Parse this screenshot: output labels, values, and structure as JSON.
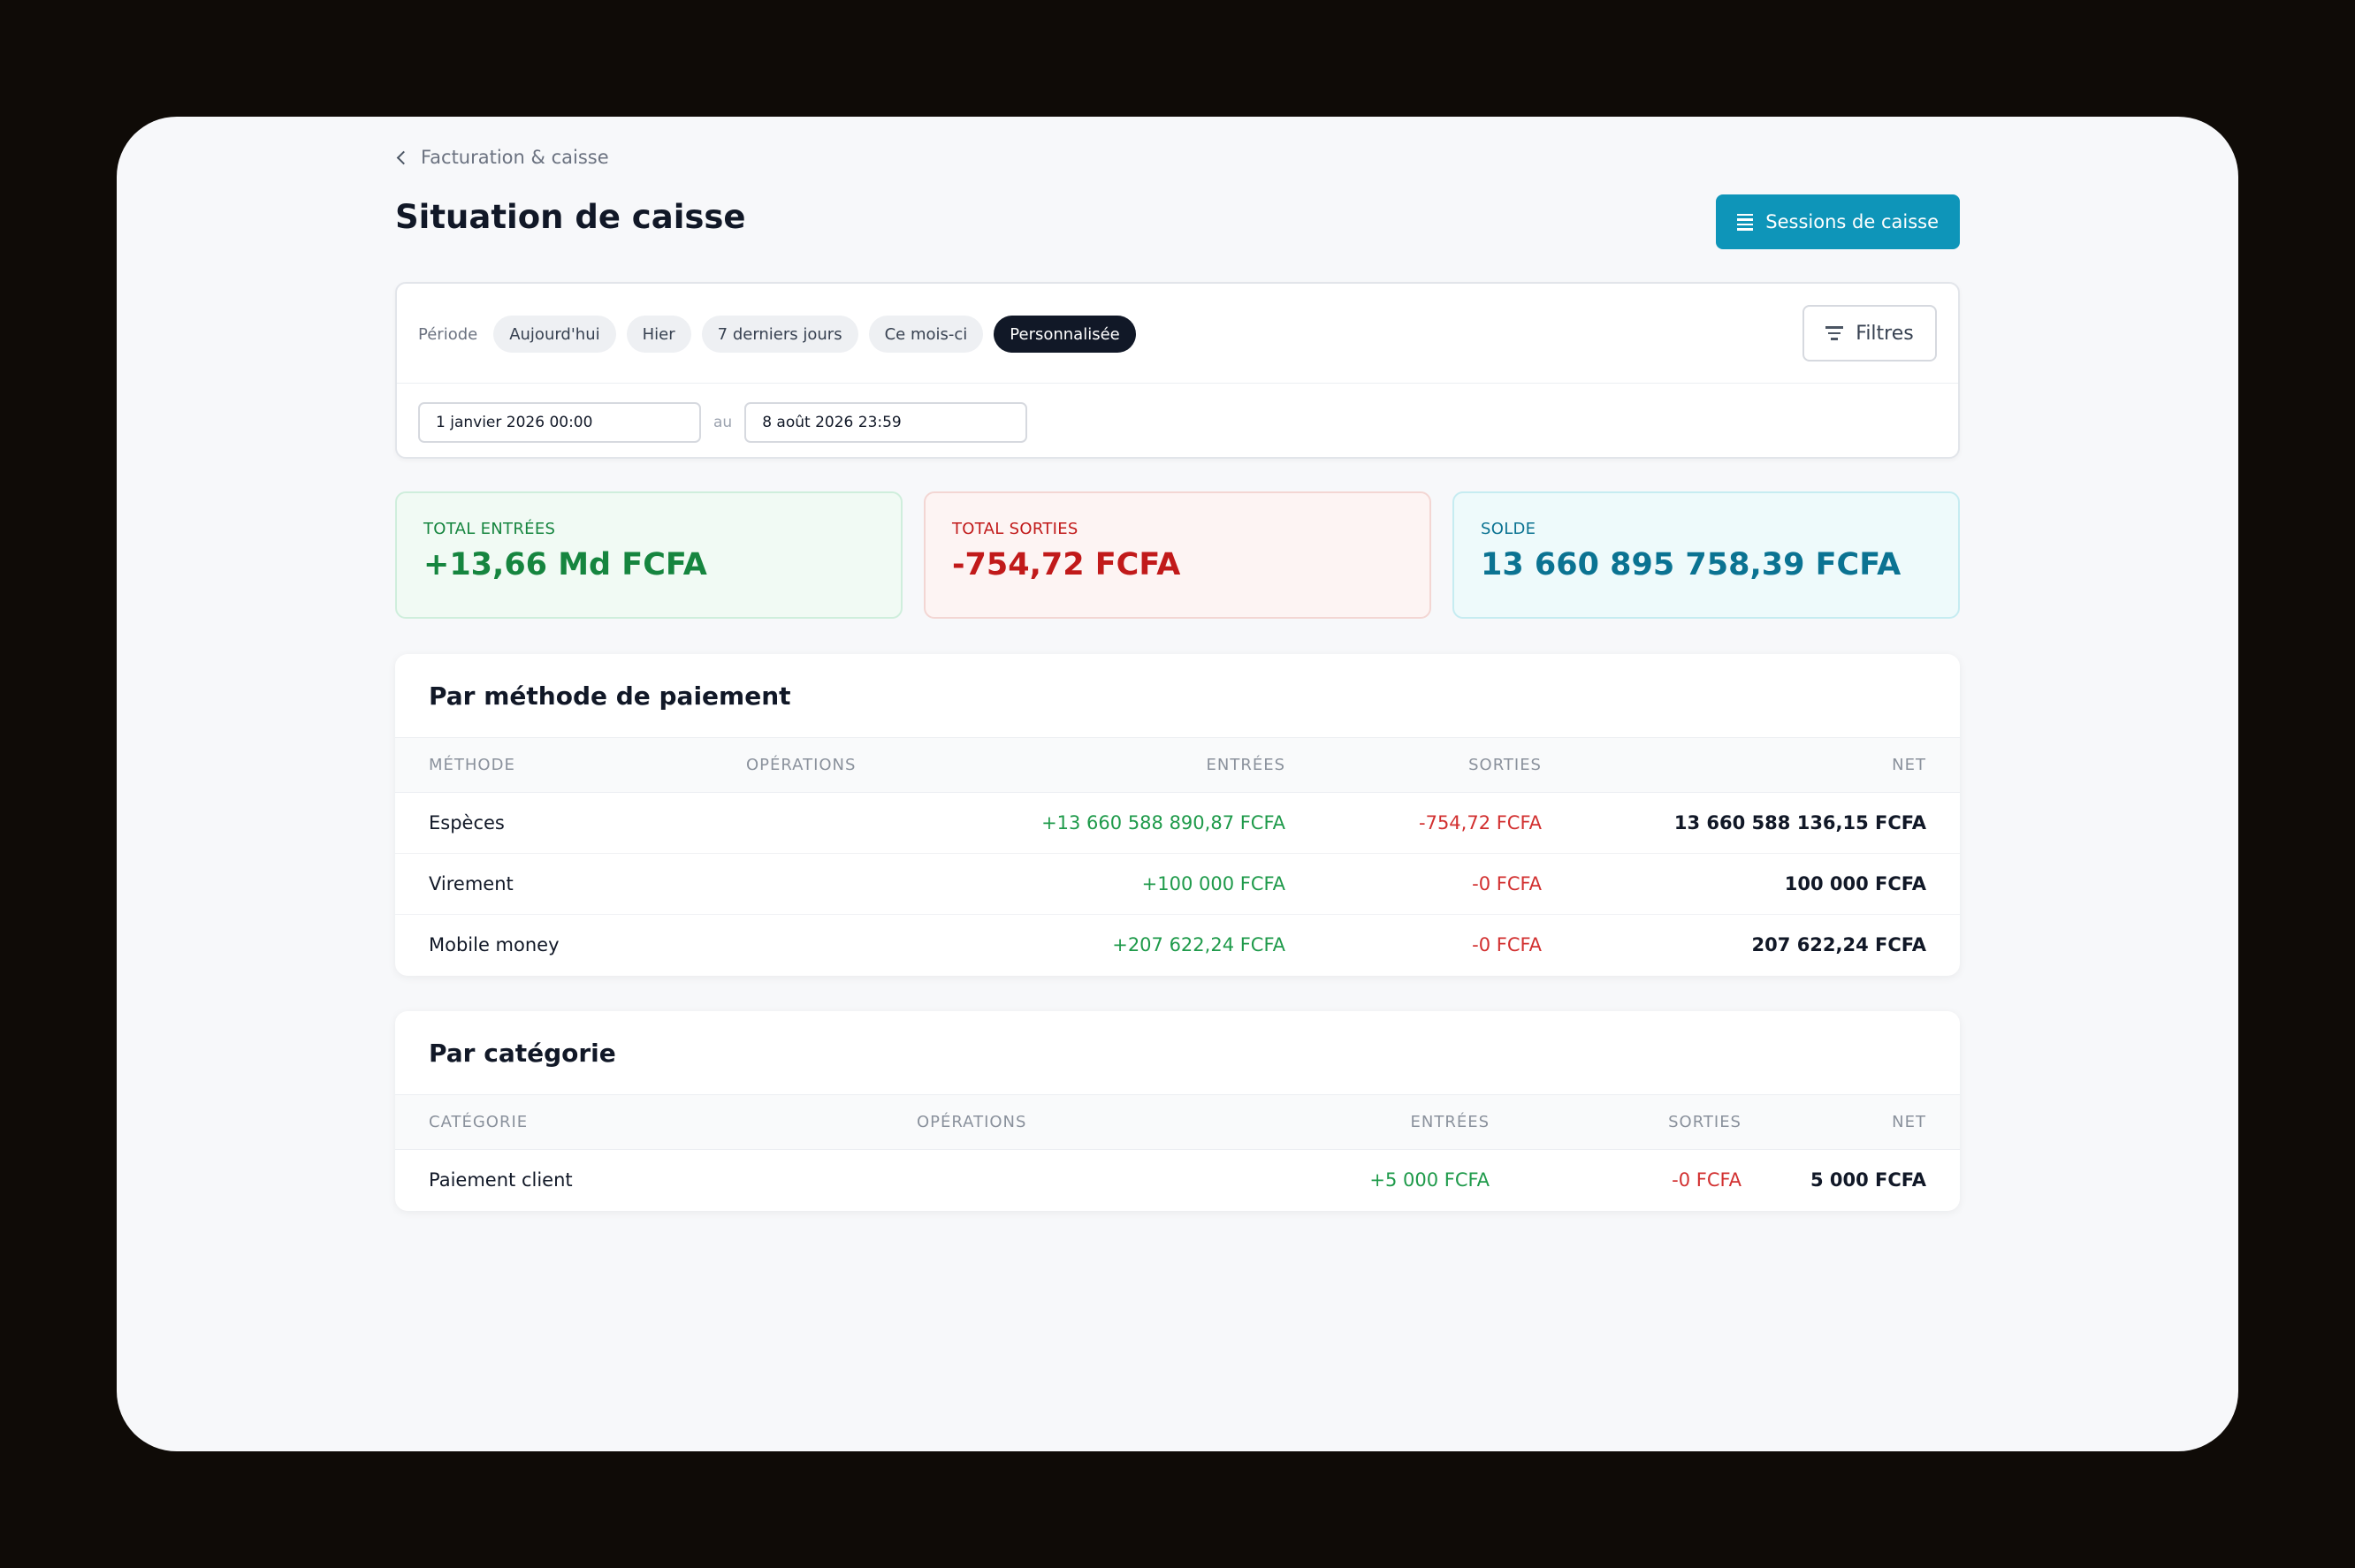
{
  "breadcrumb": {
    "label": "Facturation & caisse"
  },
  "page": {
    "title": "Situation de caisse"
  },
  "sessions_button": {
    "label": "Sessions de caisse"
  },
  "filters": {
    "period_label": "Période",
    "periods": [
      "Aujourd'hui",
      "Hier",
      "7 derniers jours",
      "Ce mois-ci",
      "Personnalisée"
    ],
    "active_period": "Personnalisée",
    "filters_label": "Filtres",
    "date_from": "1 janvier 2026 00:00",
    "date_separator": "au",
    "date_to": "8 août 2026 23:59"
  },
  "stats": {
    "in": {
      "label": "TOTAL ENTRÉES",
      "value": "+13,66 Md FCFA"
    },
    "out": {
      "label": "TOTAL SORTIES",
      "value": "-754,72 FCFA"
    },
    "balance": {
      "label": "SOLDE",
      "value": "13 660 895 758,39 FCFA"
    }
  },
  "methods": {
    "title": "Par méthode de paiement",
    "headers": [
      "MÉTHODE",
      "OPÉRATIONS",
      "ENTRÉES",
      "SORTIES",
      "NET"
    ],
    "rows": [
      {
        "name": "Espèces",
        "operations": "",
        "in": "+13 660 588 890,87 FCFA",
        "out": "-754,72 FCFA",
        "net": "13 660 588 136,15 FCFA"
      },
      {
        "name": "Virement",
        "operations": "",
        "in": "+100 000 FCFA",
        "out": "-0 FCFA",
        "net": "100 000 FCFA"
      },
      {
        "name": "Mobile money",
        "operations": "",
        "in": "+207 622,24 FCFA",
        "out": "-0 FCFA",
        "net": "207 622,24 FCFA"
      }
    ]
  },
  "categories": {
    "title": "Par catégorie",
    "headers": [
      "CATÉGORIE",
      "OPÉRATIONS",
      "ENTRÉES",
      "SORTIES",
      "NET"
    ],
    "rows": [
      {
        "name": "Paiement client",
        "operations": "",
        "in": "+5 000 FCFA",
        "out": "-0 FCFA",
        "net": "5 000 FCFA"
      }
    ]
  },
  "colors": {
    "accent": "#0e95b9",
    "positive": "#1e9a4a",
    "negative": "#d23030",
    "balance": "#0b7392"
  }
}
